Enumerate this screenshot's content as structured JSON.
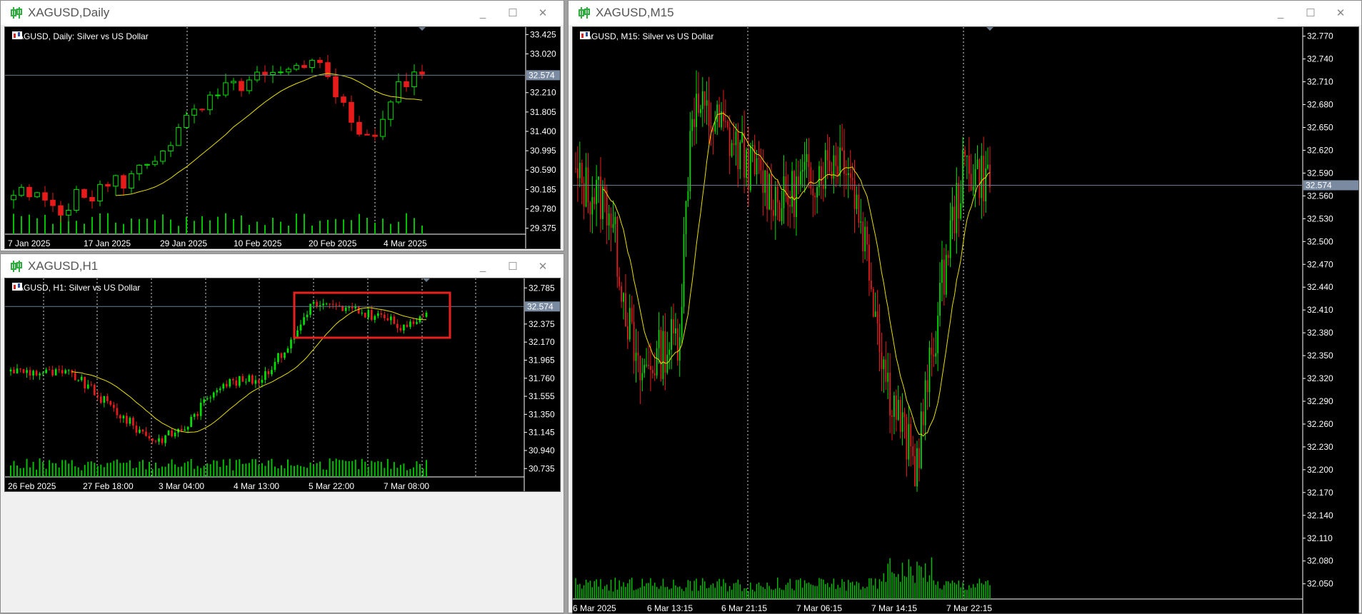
{
  "colors": {
    "bull": "#00e000",
    "bear": "#e81b1b",
    "ma": "#e8e000",
    "grid": "#ffffff",
    "axis": "#ffffff",
    "bid_line": "#6b7b8c",
    "volume": "#00c000",
    "highlight": "#e8201e",
    "price_tag_bg": "#7a8aa0"
  },
  "daily": {
    "title": "XAGUSD,Daily",
    "label": "XAGUSD, Daily:  Silver vs US Dollar",
    "price_ticks": [
      "33.425",
      "33.020",
      "32.574",
      "32.210",
      "31.805",
      "31.400",
      "30.995",
      "30.590",
      "30.185",
      "29.780",
      "29.375"
    ],
    "date_ticks": [
      "7 Jan 2025",
      "17 Jan 2025",
      "29 Jan 2025",
      "10 Feb 2025",
      "20 Feb 2025",
      "4 Mar 2025"
    ],
    "current_price": "32.574"
  },
  "h1": {
    "title": "XAGUSD,H1",
    "label": "XAGUSD, H1:  Silver vs US Dollar",
    "price_ticks": [
      "32.785",
      "32.574",
      "32.375",
      "32.170",
      "31.965",
      "31.760",
      "31.555",
      "31.350",
      "31.145",
      "30.940",
      "30.735"
    ],
    "date_ticks": [
      "26 Feb 2025",
      "27 Feb 18:00",
      "3 Mar 04:00",
      "4 Mar 13:00",
      "5 Mar 22:00",
      "7 Mar 08:00"
    ],
    "current_price": "32.574"
  },
  "m15": {
    "title": "XAGUSD,M15",
    "label": "XAGUSD, M15:  Silver vs US Dollar",
    "price_ticks": [
      "32.770",
      "32.740",
      "32.710",
      "32.680",
      "32.650",
      "32.620",
      "32.590",
      "32.574",
      "32.560",
      "32.530",
      "32.500",
      "32.470",
      "32.440",
      "32.410",
      "32.380",
      "32.350",
      "32.320",
      "32.290",
      "32.260",
      "32.230",
      "32.200",
      "32.170",
      "32.140",
      "32.110",
      "32.080",
      "32.050"
    ],
    "date_ticks": [
      "6 Mar 2025",
      "6 Mar 13:15",
      "6 Mar 21:15",
      "7 Mar 06:15",
      "7 Mar 14:15",
      "7 Mar 22:15"
    ],
    "current_price": "32.574"
  },
  "window_buttons": {
    "minimize": "_",
    "maximize": "☐",
    "close": "✕"
  }
}
